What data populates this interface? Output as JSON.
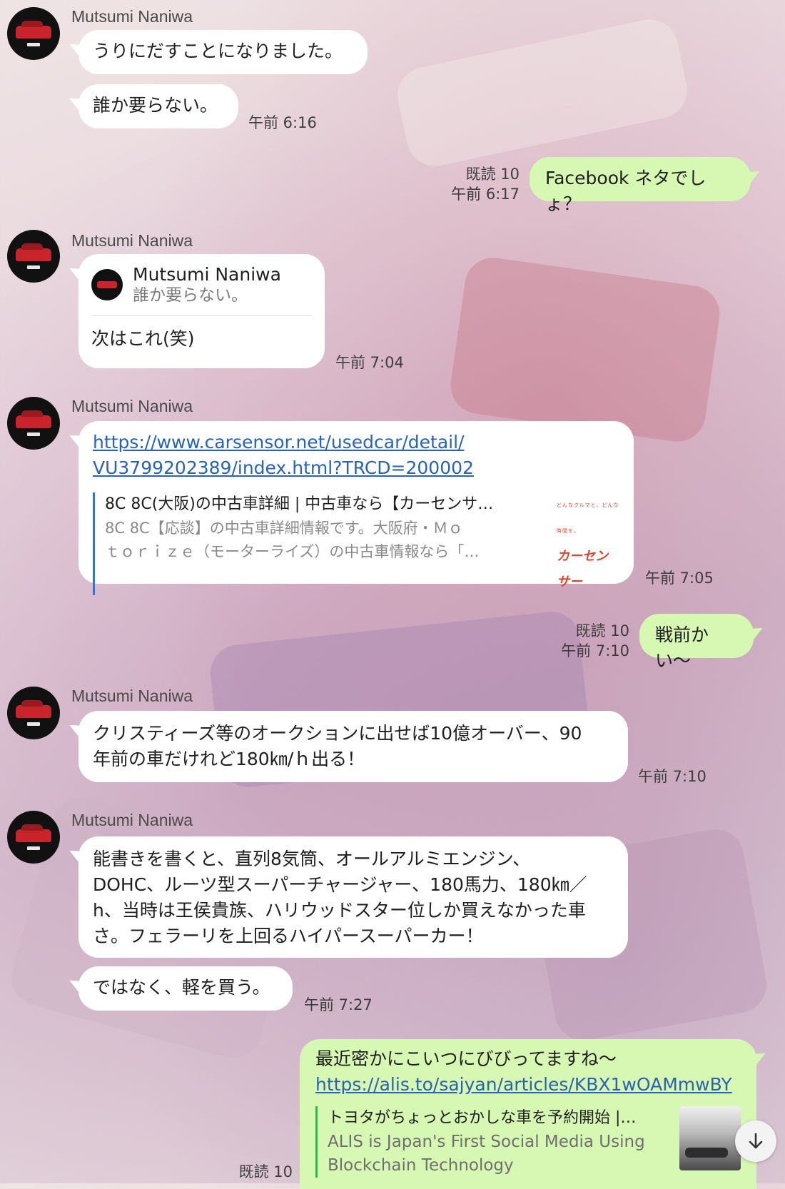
{
  "contact_name": "Mutsumi Naniwa",
  "messages": {
    "m1": {
      "sender": "Mutsumi Naniwa",
      "text": "うりにだすことになりました。"
    },
    "m2": {
      "text": "誰か要らない。",
      "time": "午前 6:16"
    },
    "m3": {
      "read": "既読 10",
      "time": "午前 6:17",
      "text": "Facebook ネタでしょ？"
    },
    "m4": {
      "sender": "Mutsumi Naniwa",
      "quote_name": "Mutsumi Naniwa",
      "quote_text": "誰か要らない。",
      "text": "次はこれ(笑)",
      "time": "午前 7:04"
    },
    "m5": {
      "sender": "Mutsumi Naniwa",
      "link_line1": "https://www.carsensor.net/usedcar/detail/",
      "link_line2": "VU3799202389/index.html?TRCD=200002",
      "preview_title": "8C 8C(大阪)の中古車詳細 | 中古車なら【カーセンサ…",
      "preview_desc1": "8C 8C【応談】の中古車詳細情報です。大阪府・Ｍｏ",
      "preview_desc2": "ｔｏｒｉｚｅ（モーターライズ）の中古車情報なら「…",
      "logo_small": "どんなクルマと、どんな時間を。",
      "logo_big": "カーセンサー",
      "time": "午前 7:05"
    },
    "m6": {
      "read": "既読 10",
      "time": "午前 7:10",
      "text": "戦前かい〜"
    },
    "m7": {
      "sender": "Mutsumi Naniwa",
      "line1": "クリスティーズ等のオークションに出せば10億オーバー、90",
      "line2": "年前の車だけれど180㎞/ｈ出る！",
      "time": "午前 7:10"
    },
    "m8": {
      "sender": "Mutsumi Naniwa",
      "line1": "能書きを書くと、直列8気筒、オールアルミエンジン、",
      "line2": "DOHC、ルーツ型スーパーチャージャー、180馬力、180㎞／",
      "line3": "h、当時は王侯貴族、ハリウッドスター位しか買えなかった車",
      "line4": "さ。フェラーリを上回るハイパースーパーカー！"
    },
    "m9": {
      "text": "ではなく、軽を買う。",
      "time": "午前 7:27"
    },
    "m10": {
      "read": "既読 10",
      "text": "最近密かにこいつにびびってますね〜",
      "link": "https://alis.to/sajyan/articles/KBX1wOAMmwBY",
      "preview_title": "トヨタがちょっとおかしな車を予約開始 |…",
      "preview_desc1": "ALIS is Japan's First Social Media Using",
      "preview_desc2": "Blockchain Technology"
    }
  },
  "scroll_button": {
    "icon": "arrow-down-icon",
    "glyph": "↓"
  }
}
